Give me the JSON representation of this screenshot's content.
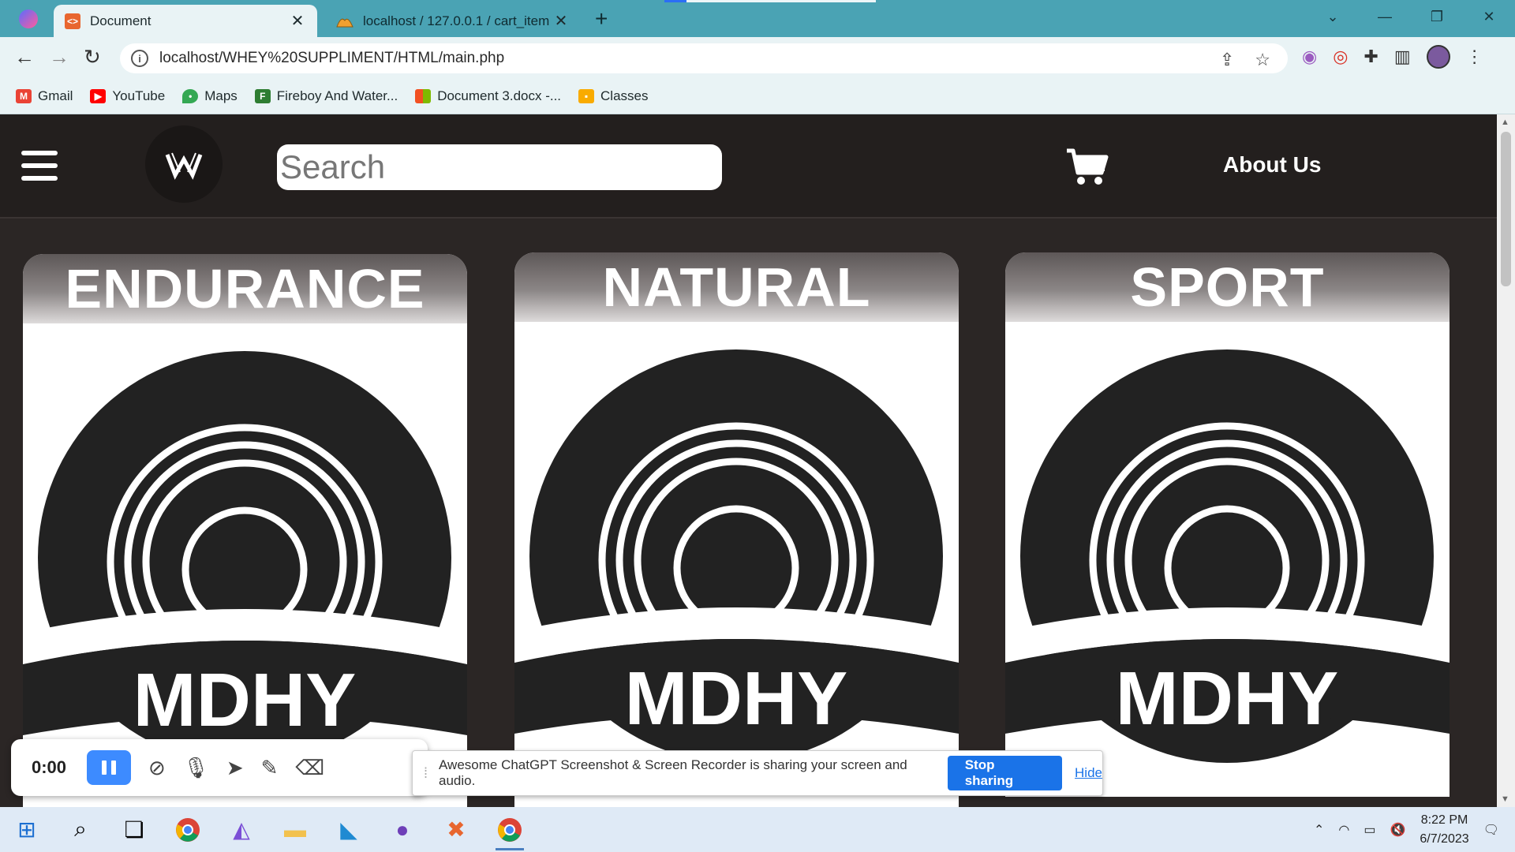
{
  "browser": {
    "tabs": [
      {
        "title": "Document",
        "active": true
      },
      {
        "title": "localhost / 127.0.0.1 / cart_item",
        "active": false
      }
    ],
    "url": "localhost/WHEY%20SUPPLIMENT/HTML/main.php",
    "bookmarks": [
      {
        "label": "Gmail",
        "icon": "gmail-icon",
        "color": "#ea4335"
      },
      {
        "label": "YouTube",
        "icon": "youtube-icon",
        "color": "#ff0000"
      },
      {
        "label": "Maps",
        "icon": "maps-icon",
        "color": "#34a853"
      },
      {
        "label": "Fireboy And Water...",
        "icon": "game-icon",
        "color": "#2e7d32"
      },
      {
        "label": "Document 3.docx -...",
        "icon": "office-icon",
        "color": "#f25022"
      },
      {
        "label": "Classes",
        "icon": "classroom-icon",
        "color": "#f9ab00"
      }
    ]
  },
  "site": {
    "search_placeholder": "Search",
    "about_label": "About Us",
    "cards": [
      {
        "title": "ENDURANCE",
        "brand": "MDHY"
      },
      {
        "title": "NATURAL",
        "brand": "MDHY"
      },
      {
        "title": "SPORT",
        "brand": "MDHY"
      }
    ]
  },
  "recorder": {
    "time": "0:00"
  },
  "share_bar": {
    "message": "Awesome ChatGPT Screenshot & Screen Recorder is sharing your screen and audio.",
    "stop_label": "Stop sharing",
    "hide_label": "Hide"
  },
  "taskbar": {
    "time": "8:22 PM",
    "date": "6/7/2023"
  },
  "colors": {
    "tabbar": "#4aa3b4",
    "chrome": "#e9f3f5",
    "page_bg": "#2b2625",
    "header_bg": "#231f1e",
    "accent": "#1a73e8"
  }
}
